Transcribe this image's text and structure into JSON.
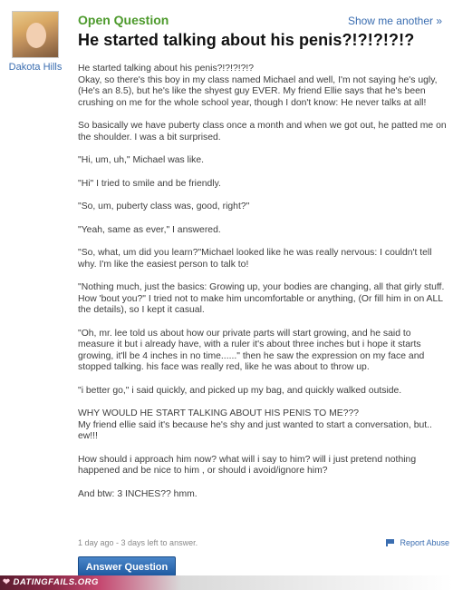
{
  "asker": {
    "name": "Dakota Hills",
    "avatar_icon": "user-avatar-photo"
  },
  "header": {
    "question_type": "Open Question",
    "show_another": "Show me another »"
  },
  "question": {
    "title": "He started talking about his penis?!?!?!?!?",
    "paragraphs": [
      "He started talking about his penis?!?!?!?!?\nOkay, so there's this boy in my class named Michael and well, I'm not saying he's ugly, (He's an 8.5), but he's like the shyest guy EVER. My friend Ellie says that he's been crushing on me for the whole school year, though I don't know: He never talks at all!",
      "So basically we have puberty class once a month and when we got out, he patted me on the shoulder. I was a bit surprised.",
      "\"Hi, um, uh,\" Michael was like.",
      "\"Hi\" I tried to smile and be friendly.",
      "\"So, um, puberty class was, good, right?\"",
      "\"Yeah, same as ever,\" I answered.",
      "\"So, what, um did you learn?\"Michael looked like he was really nervous: I couldn't tell why. I'm like the easiest person to talk to!",
      "\"Nothing much, just the basics: Growing up, your bodies are changing, all that girly stuff. How 'bout you?\" I tried not to make him uncomfortable or anything, (Or fill him in on ALL the details), so I kept it casual.",
      "\"Oh, mr. lee told us about how our private parts will start growing, and he said to measure it but i already have, with a ruler it's about three inches but i hope it starts growing, it'll be 4 inches in no time......\" then he saw the expression on my face and stopped talking. his face was really red, like he was about to throw up.",
      "\"i better go,\" i said quickly, and picked up my bag, and quickly walked outside.",
      "WHY WOULD HE START TALKING ABOUT HIS PENIS TO ME???\nMy friend ellie said it's because he's shy and just wanted to start a conversation, but.. ew!!!",
      "How should i approach him now? what will i say to him? will i just pretend nothing happened and be nice to him , or should i avoid/ignore him?",
      "And btw: 3 INCHES?? hmm."
    ],
    "meta": "1 day ago - 3 days left to answer.",
    "report_label": "Report Abuse",
    "answer_button": "Answer Question"
  },
  "watermark": {
    "text": "DATINGFAILS.ORG",
    "heart_icon": "heart-icon"
  },
  "colors": {
    "question_type": "#4d9a2c",
    "link": "#3a6db0",
    "button": "#2a67b0",
    "footer_strip": "#8e2a48"
  }
}
